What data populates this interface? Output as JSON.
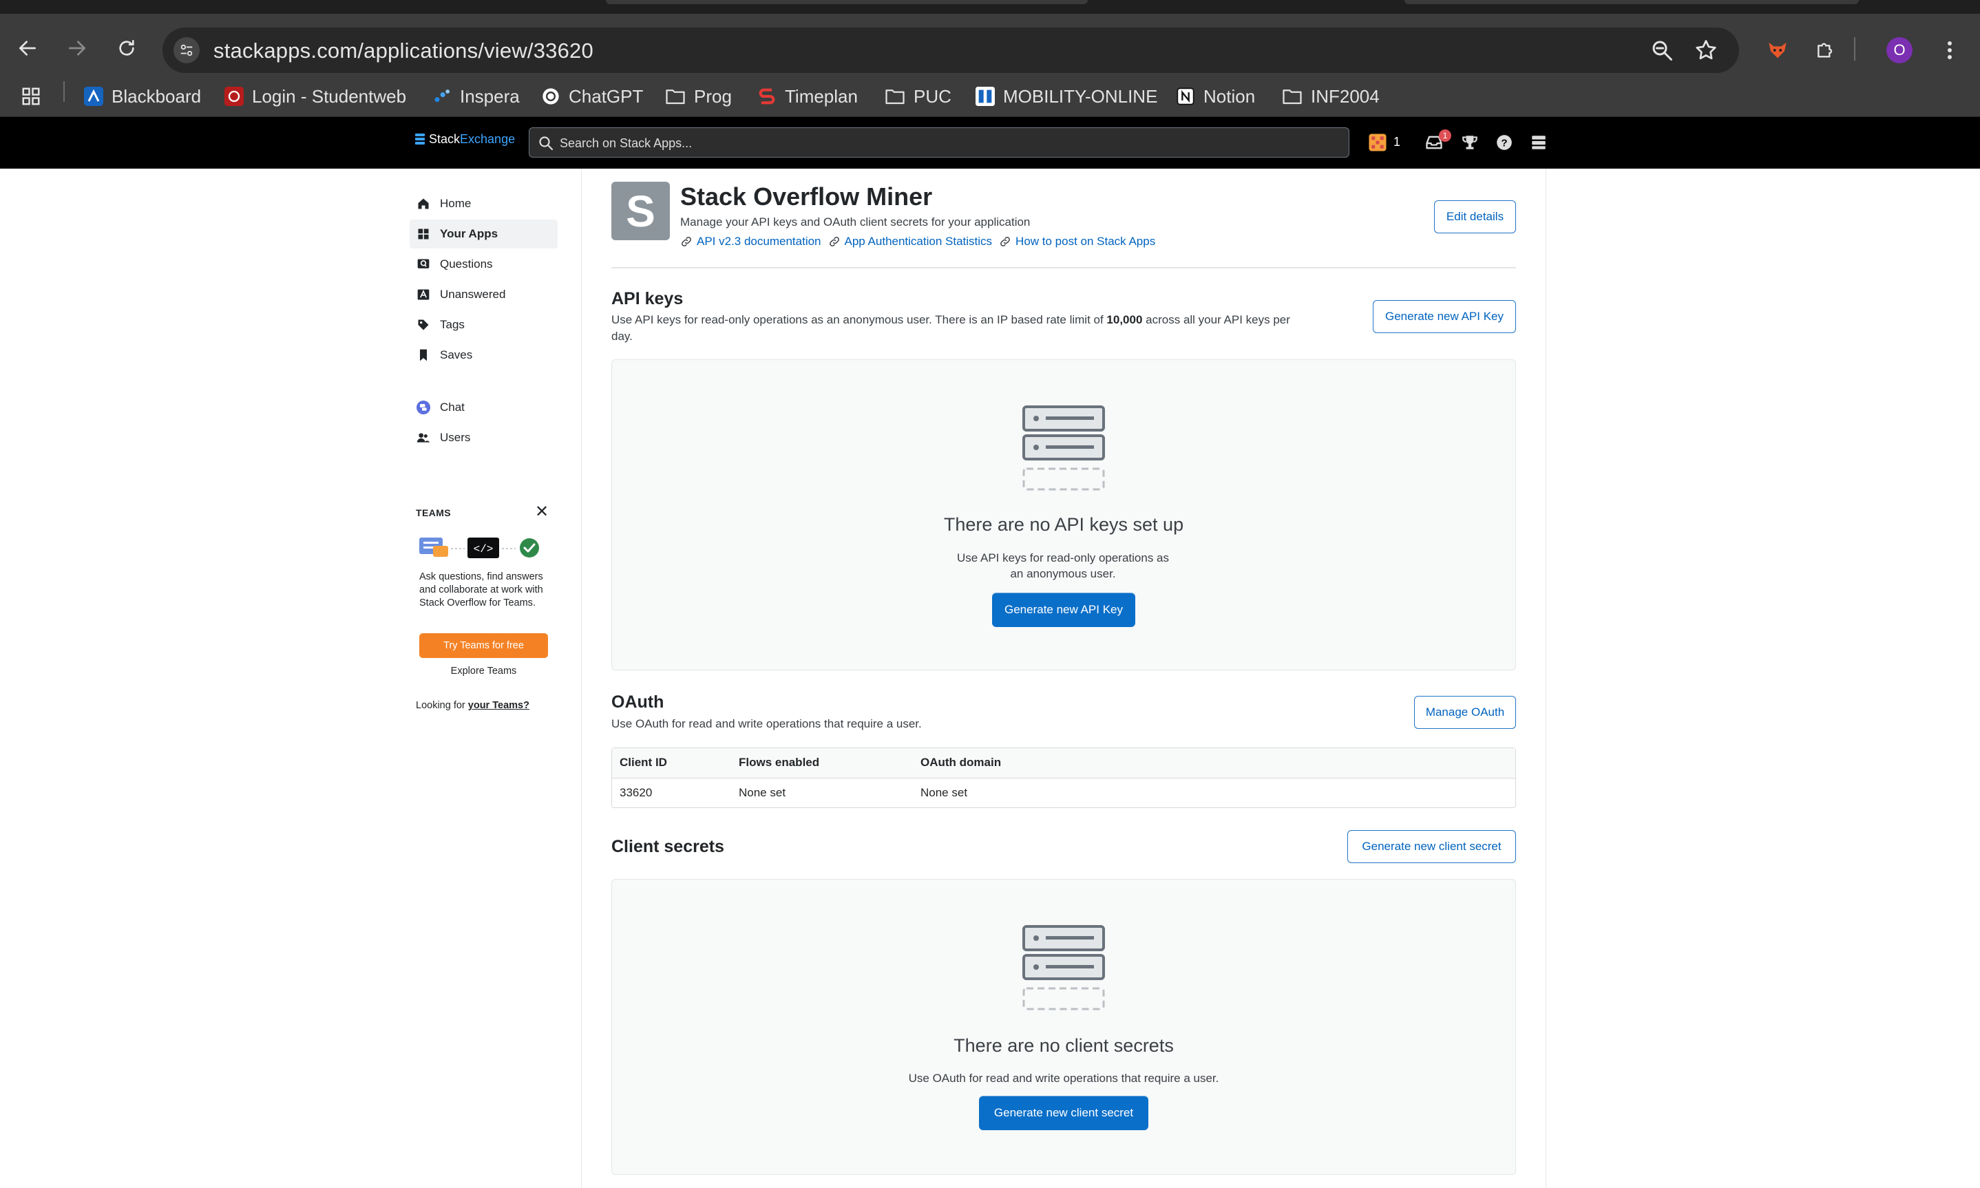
{
  "browser": {
    "url": "stackapps.com/applications/view/33620",
    "profile_initial": "O",
    "bookmarks": [
      {
        "label": "Blackboard",
        "icon": "blackboard-icon",
        "color": "#1565c0"
      },
      {
        "label": "Login - Studentweb",
        "icon": "studentweb-icon",
        "color": "#c62828"
      },
      {
        "label": "Inspera",
        "icon": "inspera-icon",
        "color": "#1e88e5"
      },
      {
        "label": "ChatGPT",
        "icon": "chatgpt-icon",
        "color": "#ffffff"
      },
      {
        "label": "Prog",
        "icon": "folder-icon",
        "color": "#e3e3e3"
      },
      {
        "label": "Timeplan",
        "icon": "timeplan-icon",
        "color": "#e53935"
      },
      {
        "label": "PUC",
        "icon": "folder-icon",
        "color": "#e3e3e3"
      },
      {
        "label": "MOBILITY-ONLINE",
        "icon": "mobility-icon",
        "color": "#1565c0"
      },
      {
        "label": "Notion",
        "icon": "notion-icon",
        "color": "#ffffff"
      },
      {
        "label": "INF2004",
        "icon": "folder-icon",
        "color": "#e3e3e3"
      }
    ]
  },
  "topbar": {
    "logo_stack": "Stack",
    "logo_exchange": "Exchange",
    "search_placeholder": "Search on Stack Apps...",
    "rep_count": "1",
    "inbox_badge": "1"
  },
  "sidebar": {
    "items": [
      {
        "label": "Home",
        "icon": "home-icon"
      },
      {
        "label": "Your Apps",
        "icon": "apps-grid-icon",
        "active": true
      },
      {
        "label": "Questions",
        "icon": "questions-icon"
      },
      {
        "label": "Unanswered",
        "icon": "unanswered-icon"
      },
      {
        "label": "Tags",
        "icon": "tag-icon"
      },
      {
        "label": "Saves",
        "icon": "bookmark-icon"
      },
      {
        "label": "Chat",
        "icon": "chat-icon"
      },
      {
        "label": "Users",
        "icon": "users-icon"
      }
    ],
    "teams": {
      "title": "TEAMS",
      "description": "Ask questions, find answers and collaborate at work with Stack Overflow for Teams.",
      "cta": "Try Teams for free",
      "explore": "Explore Teams",
      "looking_prefix": "Looking for ",
      "looking_link": "your Teams?"
    }
  },
  "app": {
    "avatar_letter": "S",
    "title": "Stack Overflow Miner",
    "subtitle": "Manage your API keys and OAuth client secrets for your application",
    "links": [
      "API v2.3 documentation",
      "App Authentication Statistics",
      "How to post on Stack Apps"
    ],
    "edit_button": "Edit details"
  },
  "api_keys": {
    "title": "API keys",
    "desc_before": "Use API keys for read-only operations as an anonymous user. There is an IP based rate limit of ",
    "desc_bold": "10,000",
    "desc_after": " across all your API keys per day.",
    "generate_button": "Generate new API Key",
    "empty_title": "There are no API keys set up",
    "empty_desc": "Use API keys for read-only operations as an anonymous user.",
    "empty_button": "Generate new API Key"
  },
  "oauth": {
    "title": "OAuth",
    "desc": "Use OAuth for read and write operations that require a user.",
    "manage_button": "Manage OAuth",
    "columns": [
      "Client ID",
      "Flows enabled",
      "OAuth domain"
    ],
    "rows": [
      [
        "33620",
        "None set",
        "None set"
      ]
    ]
  },
  "client_secrets": {
    "title": "Client secrets",
    "generate_button": "Generate new client secret",
    "empty_title": "There are no client secrets",
    "empty_desc": "Use OAuth for read and write operations that require a user.",
    "empty_button": "Generate new client secret"
  },
  "colors": {
    "link": "#0063bf",
    "primary_button": "#0a6fc9",
    "teams_button": "#f48225",
    "empty_bg": "#f8f9f9"
  }
}
